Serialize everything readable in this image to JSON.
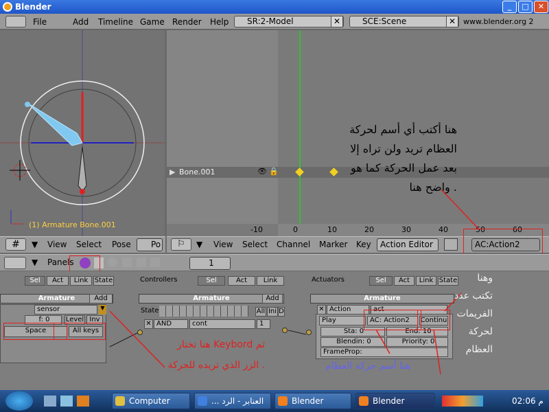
{
  "window": {
    "title": "Blender"
  },
  "menu": {
    "items": [
      "File",
      "Add",
      "Timeline",
      "Game",
      "Render",
      "Help"
    ],
    "screen": "SR:2-Model",
    "scene": "SCE:Scene",
    "website": "www.blender.org 2"
  },
  "viewport": {
    "object_label": "(1) Armature Bone.001"
  },
  "view3d_header": {
    "items": [
      "View",
      "Select",
      "Pose"
    ],
    "mode": "Po"
  },
  "action_editor": {
    "channel": "Bone.001",
    "ruler": [
      "-10",
      "0",
      "10",
      "20",
      "30",
      "40",
      "50",
      "60"
    ],
    "header": [
      "View",
      "Select",
      "Channel",
      "Marker",
      "Key"
    ],
    "editor_mode": "Action Editor",
    "action_field": "AC:Action2"
  },
  "annotations": {
    "top": [
      "هنا أكتب أي أسم لحركة",
      "العظام تريد ولن تراه إلا",
      "بعد عمل الحركة كما هو",
      "واضح هنا ."
    ],
    "right": [
      "وهنا",
      "تكتب عدد",
      "الفريمات",
      "لحركة",
      "العظام"
    ],
    "keyboard": [
      "هنا تختار Keybord ثم",
      "الزر الذي تريده للحركة ."
    ],
    "action_name": "هنا أسم حركة العظام"
  },
  "panels_header": {
    "label": "Panels",
    "frame": "1"
  },
  "logic": {
    "sel": "Sel",
    "act": "Act",
    "link": "Link",
    "state": "State",
    "controllers": "Controllers",
    "actuators": "Actuators",
    "armature": "Armature",
    "add": "Add",
    "sensor": {
      "name": "sensor",
      "f": "f: 0",
      "level": "Level",
      "inv": "Inv",
      "key": "Space",
      "all_keys": "All keys"
    },
    "controller": {
      "state": "State",
      "all": "All",
      "ini": "Ini",
      "d": "D",
      "type": "AND",
      "name": "cont",
      "num": "1"
    },
    "actuator": {
      "type": "Action",
      "name": "act",
      "mode": "Play",
      "action": "AC: Action2",
      "cont": "Continu",
      "sta": "Sta: 0",
      "end": "End: 10",
      "blendin": "Blendin: 0",
      "priority": "Priority: 0",
      "frameprop": "FrameProp:"
    }
  },
  "taskbar": {
    "buttons": [
      "Computer",
      "... العنابر - الرد",
      "Blender",
      "Blender"
    ],
    "time": "02:06 م"
  },
  "colors": {
    "accent_green": "#30c030",
    "key_yellow": "#f0d020",
    "annotation_red": "#e02020",
    "annotation_blue": "#6464f0"
  }
}
